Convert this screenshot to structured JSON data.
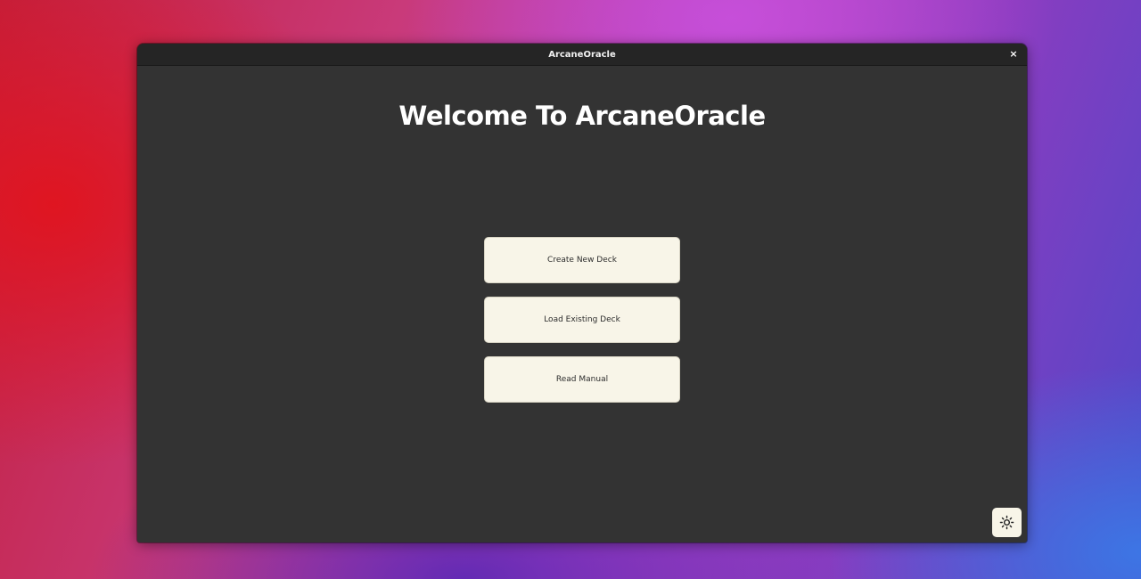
{
  "window": {
    "title": "ArcaneOracle",
    "close_glyph": "×"
  },
  "main": {
    "heading": "Welcome To ArcaneOracle",
    "buttons": [
      {
        "label": "Create New Deck"
      },
      {
        "label": "Load Existing Deck"
      },
      {
        "label": "Read Manual"
      }
    ],
    "theme_toggle_icon": "sun-icon"
  },
  "colors": {
    "window_bg": "#333333",
    "titlebar_bg": "#252525",
    "button_bg": "#f8f5e8",
    "heading_text": "#ffffff"
  }
}
